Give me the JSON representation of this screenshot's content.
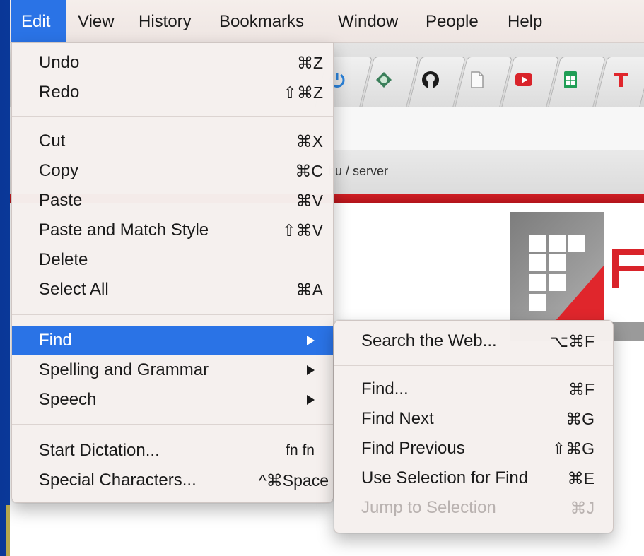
{
  "menubar": {
    "items": [
      "Edit",
      "View",
      "History",
      "Bookmarks",
      "Window",
      "People",
      "Help"
    ],
    "active": "Edit"
  },
  "browser": {
    "address_text": "hu / server",
    "tab_icons": [
      "power-icon",
      "shield-icon",
      "github-icon",
      "document-icon",
      "youtube-icon",
      "sheets-icon",
      "t-icon"
    ],
    "accent_red": "#d11f25"
  },
  "edit_menu": {
    "undo": {
      "label": "Undo",
      "shortcut": "⌘Z"
    },
    "redo": {
      "label": "Redo",
      "shortcut": "⇧⌘Z"
    },
    "cut": {
      "label": "Cut",
      "shortcut": "⌘X"
    },
    "copy": {
      "label": "Copy",
      "shortcut": "⌘C"
    },
    "paste": {
      "label": "Paste",
      "shortcut": "⌘V"
    },
    "paste_match": {
      "label": "Paste and Match Style",
      "shortcut": "⇧⌘V"
    },
    "delete": {
      "label": "Delete"
    },
    "select_all": {
      "label": "Select All",
      "shortcut": "⌘A"
    },
    "find": {
      "label": "Find"
    },
    "spelling": {
      "label": "Spelling and Grammar"
    },
    "speech": {
      "label": "Speech"
    },
    "dictation": {
      "label": "Start Dictation...",
      "shortcut": "fn fn"
    },
    "special_chars": {
      "label": "Special Characters...",
      "shortcut": "^⌘Space"
    }
  },
  "find_menu": {
    "search_web": {
      "label": "Search the Web...",
      "shortcut": "⌥⌘F"
    },
    "find": {
      "label": "Find...",
      "shortcut": "⌘F"
    },
    "find_next": {
      "label": "Find Next",
      "shortcut": "⌘G"
    },
    "find_previous": {
      "label": "Find Previous",
      "shortcut": "⇧⌘G"
    },
    "use_selection": {
      "label": "Use Selection for Find",
      "shortcut": "⌘E"
    },
    "jump_selection": {
      "label": "Jump to Selection",
      "shortcut": "⌘J",
      "enabled": false
    }
  },
  "colors": {
    "highlight": "#2a73e6",
    "menu_bg": "#f5f0ee",
    "desktop": "#0b3fa8"
  }
}
